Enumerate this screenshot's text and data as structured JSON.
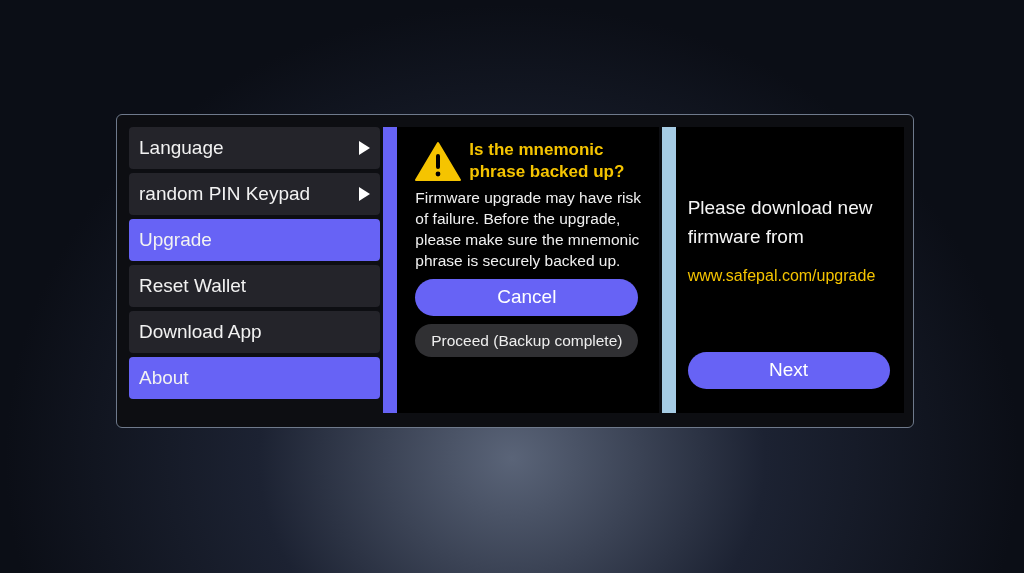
{
  "menu": {
    "items": [
      {
        "label": "Language",
        "selected": false,
        "submenu": true
      },
      {
        "label": "random PIN Keypad",
        "selected": false,
        "submenu": true
      },
      {
        "label": "Upgrade",
        "selected": true,
        "submenu": false
      },
      {
        "label": "Reset Wallet",
        "selected": false,
        "submenu": false
      },
      {
        "label": "Download App",
        "selected": false,
        "submenu": false
      },
      {
        "label": "About",
        "selected": true,
        "submenu": false
      }
    ]
  },
  "dialog": {
    "title": "Is the mnemonic phrase backed up?",
    "message": "Firmware upgrade may have risk of failure. Before the upgrade, please make sure the mnemonic phrase is securely backed up.",
    "buttons": [
      {
        "label": "Cancel",
        "kind": "primary"
      },
      {
        "label": "Proceed (Backup complete)",
        "kind": "secondary"
      }
    ]
  },
  "download": {
    "message": "Please download new firmware from",
    "link": "www.safepal.com/upgrade",
    "button": "Next"
  }
}
